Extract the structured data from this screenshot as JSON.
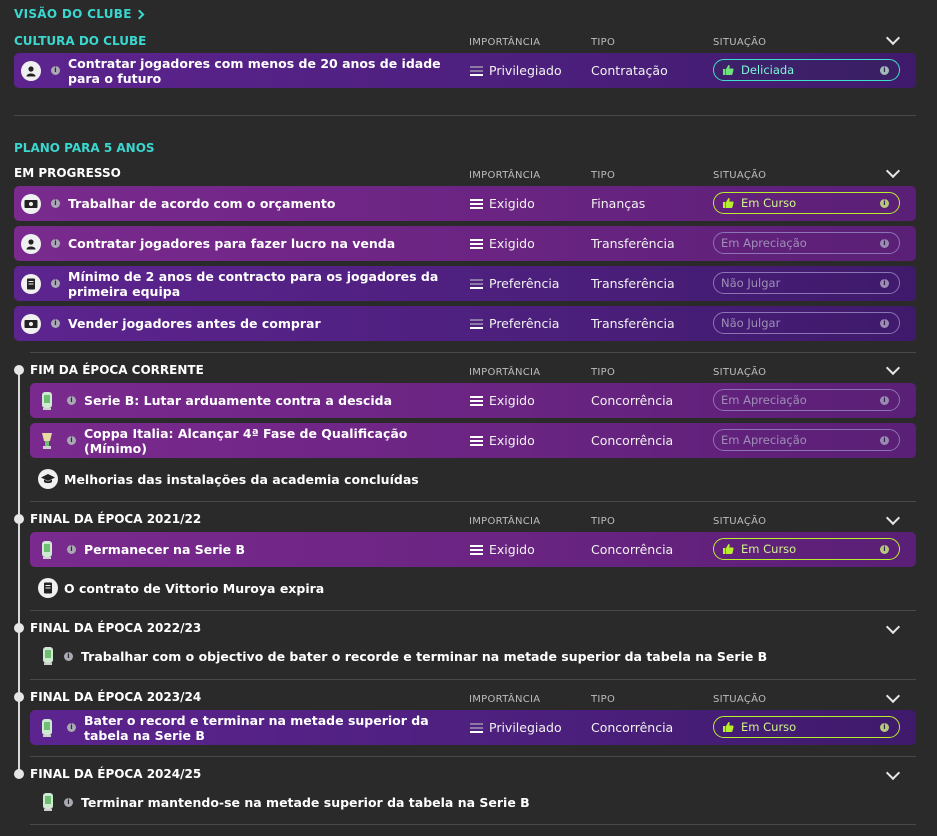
{
  "header": {
    "link": "VISÃO DO CLUBE"
  },
  "columns": {
    "importance": "IMPORTÂNCIA",
    "type": "TIPO",
    "status": "SITUAÇÃO"
  },
  "culture": {
    "title": "CULTURA DO CLUBE",
    "rows": [
      {
        "icon": "person-icon",
        "title": "Contratar jogadores com menos de 20 anos de idade para o futuro",
        "importance": "Privilegiado",
        "type": "Contratação",
        "status": "Deliciada"
      }
    ]
  },
  "plan": {
    "title": "PLANO PARA 5 ANOS"
  },
  "groups": [
    {
      "title": "EM PROGRESSO",
      "rows": [
        {
          "icon": "money-icon",
          "title": "Trabalhar de acordo com o orçamento",
          "importance": "Exigido",
          "type": "Finanças",
          "status": "Em Curso"
        },
        {
          "icon": "person-icon",
          "title": "Contratar jogadores para fazer lucro na venda",
          "importance": "Exigido",
          "type": "Transferência",
          "status": "Em Apreciação"
        },
        {
          "icon": "contract-icon",
          "title": "Mínimo de 2 anos de contracto para os jogadores da primeira equipa",
          "importance": "Preferência",
          "type": "Transferência",
          "status": "Não Julgar"
        },
        {
          "icon": "money-icon",
          "title": "Vender jogadores antes de comprar",
          "importance": "Preferência",
          "type": "Transferência",
          "status": "Não Julgar"
        }
      ]
    },
    {
      "title": "FIM DA ÉPOCA CORRENTE",
      "rows": [
        {
          "icon": "serie-b-trophy-icon",
          "title": "Serie B: Lutar arduamente contra a descida",
          "importance": "Exigido",
          "type": "Concorrência",
          "status": "Em Apreciação"
        },
        {
          "icon": "coppa-italia-icon",
          "title": "Coppa Italia: Alcançar 4ª Fase de Qualificação (Mínimo)",
          "importance": "Exigido",
          "type": "Concorrência",
          "status": "Em Apreciação"
        }
      ],
      "event": "Melhorias das instalações da academia concluídas"
    },
    {
      "title": "FINAL DA ÉPOCA 2021/22",
      "rows": [
        {
          "icon": "serie-b-trophy-icon",
          "title": "Permanecer na Serie B",
          "importance": "Exigido",
          "type": "Concorrência",
          "status": "Em Curso"
        }
      ],
      "event": "O contrato de Vittorio Muroya expira"
    },
    {
      "title": "FINAL DA ÉPOCA 2022/23",
      "note": "Trabalhar com o objectivo de bater o recorde e terminar na metade superior da tabela na Serie B"
    },
    {
      "title": "FINAL DA ÉPOCA 2023/24",
      "rows": [
        {
          "icon": "serie-b-trophy-icon",
          "title": "Bater o record e terminar na metade superior da tabela na Serie B",
          "importance": "Privilegiado",
          "type": "Concorrência",
          "status": "Em Curso"
        }
      ]
    },
    {
      "title": "FINAL DA ÉPOCA 2024/25",
      "note": "Terminar mantendo-se na metade superior da tabela na Serie B"
    }
  ]
}
